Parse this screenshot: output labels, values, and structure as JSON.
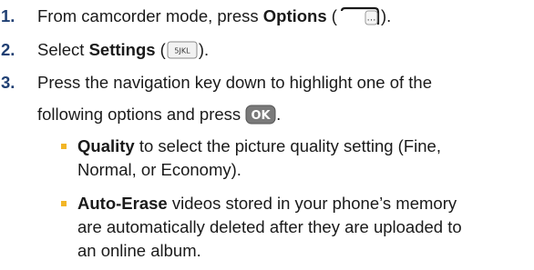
{
  "steps": [
    {
      "number": "1.",
      "text_before": "From camcorder mode, press ",
      "bold": "Options",
      "text_paren_open": " (",
      "key_label": "…",
      "text_after": ")."
    },
    {
      "number": "2.",
      "text_before": "Select ",
      "bold": "Settings",
      "text_paren_open": " (",
      "key_label": "5JKL",
      "text_after": ")."
    },
    {
      "number": "3.",
      "line1": "Press the navigation key down to highlight one of the",
      "line2_before": "following options and press",
      "key_label": "OK",
      "line2_after": "."
    }
  ],
  "options": [
    {
      "bold": "Quality",
      "line1_rest": " to select the picture quality setting (Fine,",
      "line2": "Normal, or Economy)."
    },
    {
      "bold": "Auto-Erase",
      "line1_rest": " videos stored in your phone’s memory",
      "line2": "are automatically deleted after they are uploaded to",
      "line3": "an online album."
    }
  ],
  "colors": {
    "step_number": "#1f3f73",
    "bullet": "#f2b526",
    "ok_key": "#7a7a7a"
  }
}
